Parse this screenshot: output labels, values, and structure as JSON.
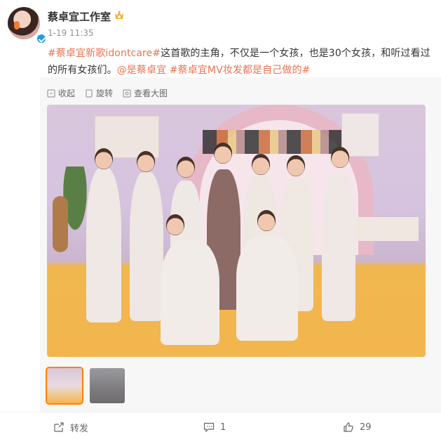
{
  "post": {
    "username": "蔡卓宜工作室",
    "timestamp": "1-19 11:35",
    "text_parts": [
      {
        "text": "#蔡卓宜新歌idontcare#",
        "type": "tag"
      },
      {
        "text": "这首歌的主角，不仅是一个女孩，也是30个女孩，和听过看过的所有女孩们。",
        "type": "text"
      },
      {
        "text": "@是蔡卓宜",
        "type": "tag"
      },
      {
        "text": " ",
        "type": "text"
      },
      {
        "text": "#蔡卓宜MV妆发都是自己做的#",
        "type": "tag"
      }
    ]
  },
  "toolbar": {
    "collapse": "收起",
    "rotate": "旋转",
    "view_large": "查看大图"
  },
  "actions": {
    "repost": "转发",
    "comment_count": "1",
    "like_count": "29"
  },
  "colors": {
    "link": "#eb7350",
    "verified": "#1d9bf0",
    "thumb_selected_border": "#ff8200"
  },
  "icons": [
    "crown-icon",
    "verified-icon",
    "collapse-icon",
    "rotate-icon",
    "view-large-icon",
    "repost-icon",
    "comment-icon",
    "like-icon"
  ]
}
